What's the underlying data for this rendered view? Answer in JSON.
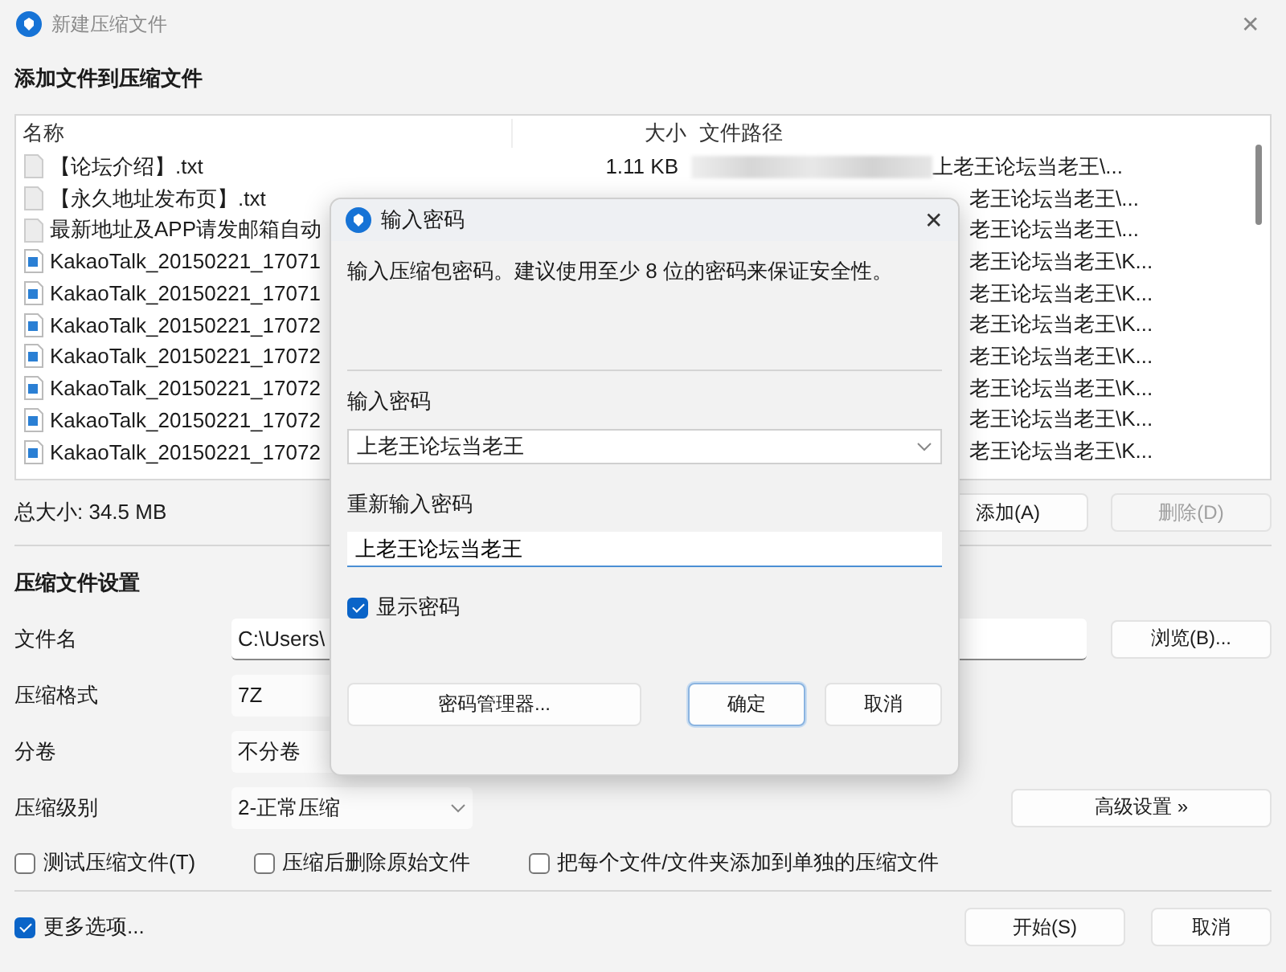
{
  "window": {
    "title": "新建压缩文件",
    "close": "✕"
  },
  "files_section": {
    "heading": "添加文件到压缩文件",
    "columns": [
      "名称",
      "大小",
      "文件路径"
    ],
    "rows": [
      {
        "kind": "text",
        "name": "【论坛介绍】.txt",
        "size": "1.11 KB",
        "path": "上老王论坛当老王\\...",
        "redacted": true
      },
      {
        "kind": "text",
        "name": "【永久地址发布页】.txt",
        "path": "老王论坛当老王\\...",
        "redacted": false
      },
      {
        "kind": "text",
        "name": "最新地址及APP请发邮箱自动",
        "path": "老王论坛当老王\\...",
        "redacted": false
      },
      {
        "kind": "image",
        "name": "KakaoTalk_20150221_17071",
        "path": "老王论坛当老王\\K...",
        "redacted": false
      },
      {
        "kind": "image",
        "name": "KakaoTalk_20150221_17071",
        "path": "老王论坛当老王\\K...",
        "redacted": false
      },
      {
        "kind": "image",
        "name": "KakaoTalk_20150221_17072",
        "path": "老王论坛当老王\\K...",
        "redacted": false
      },
      {
        "kind": "image",
        "name": "KakaoTalk_20150221_17072",
        "path": "老王论坛当老王\\K...",
        "redacted": false
      },
      {
        "kind": "image",
        "name": "KakaoTalk_20150221_17072",
        "path": "老王论坛当老王\\K...",
        "redacted": false
      },
      {
        "kind": "image",
        "name": "KakaoTalk_20150221_17072",
        "path": "老王论坛当老王\\K...",
        "redacted": false
      },
      {
        "kind": "image",
        "name": "KakaoTalk_20150221_17072",
        "path": "老王论坛当老王\\K...",
        "redacted": false
      }
    ],
    "total_size": "总大小: 34.5 MB",
    "buttons": [
      {
        "label": "添加(A)",
        "disabled": false
      },
      {
        "label": "删除(D)",
        "disabled": true
      }
    ]
  },
  "settings": {
    "heading": "压缩文件设置",
    "fields": [
      {
        "label": "文件名",
        "kind": "text",
        "value": "C:\\Users\\"
      },
      {
        "label": "压缩格式",
        "kind": "plain",
        "value": "7Z"
      },
      {
        "label": "分卷",
        "kind": "plain",
        "value": "不分卷"
      },
      {
        "label": "压缩级别",
        "kind": "dropdown",
        "value": "2-正常压缩"
      }
    ],
    "browse_button": "浏览(B)...",
    "advanced_button": "高级设置 »",
    "options": [
      {
        "label": "测试压缩文件(T)",
        "checked": false
      },
      {
        "label": "压缩后删除原始文件",
        "checked": false
      },
      {
        "label": "把每个文件/文件夹添加到单独的压缩文件",
        "checked": false
      }
    ]
  },
  "more_options": {
    "label": "更多选项...",
    "checked": true
  },
  "footer_buttons": [
    "开始(S)",
    "取消"
  ],
  "dialog": {
    "title": "输入密码",
    "close": "✕",
    "description": "输入压缩包密码。建议使用至少 8 位的密码来保证安全性。",
    "password_label": "输入密码",
    "password": "上老王论坛当老王",
    "confirm_label": "重新输入密码",
    "confirm": "上老王论坛当老王",
    "show_password": {
      "label": "显示密码",
      "checked": true
    },
    "buttons": [
      {
        "label": "密码管理器...",
        "kind": "wide",
        "default": false
      },
      {
        "label": "确定",
        "kind": "normal",
        "default": true
      },
      {
        "label": "取消",
        "kind": "normal",
        "default": false
      }
    ]
  }
}
